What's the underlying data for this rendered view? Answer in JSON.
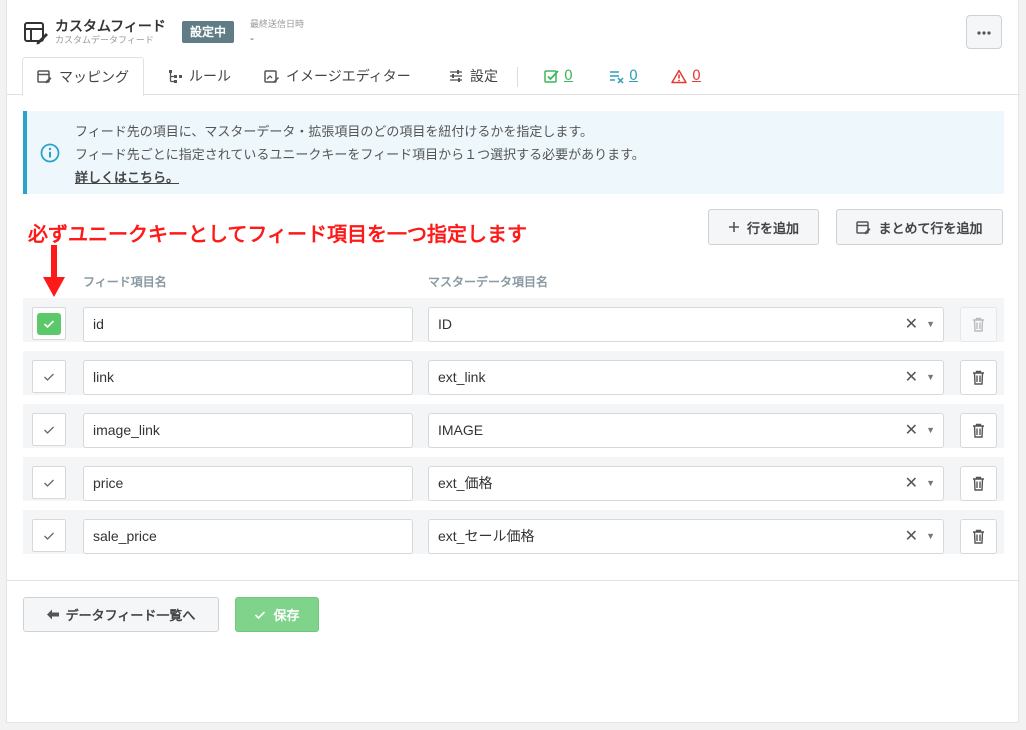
{
  "header": {
    "title": "カスタムフィード",
    "subtitle": "カスタムデータフィード",
    "status_badge": "設定中",
    "last_sent_label": "最終送信日時",
    "last_sent_value": "-",
    "more_icon": "more-horizontal-icon"
  },
  "tabs": [
    {
      "label": "マッピング",
      "icon": "mapping-icon",
      "active": true
    },
    {
      "label": "ルール",
      "icon": "rule-tree-icon",
      "active": false
    },
    {
      "label": "イメージエディター",
      "icon": "image-editor-icon",
      "active": false
    },
    {
      "label": "設定",
      "icon": "settings-sliders-icon",
      "active": false
    }
  ],
  "counters": [
    {
      "value": "0",
      "icon": "check-badge-icon",
      "color": "#3cb55b"
    },
    {
      "value": "0",
      "icon": "excluded-list-icon",
      "color": "#2aa0b8"
    },
    {
      "value": "0",
      "icon": "warning-icon",
      "color": "#e53935"
    }
  ],
  "info": {
    "line1": "フィード先の項目に、マスターデータ・拡張項目のどの項目を紐付けるかを指定します。",
    "line2": "フィード先ごとに指定されているユニークキーをフィード項目から１つ選択する必要があります。",
    "link": "詳しくはこちら。",
    "accent_color": "#27a4c8"
  },
  "annotation": "必ずユニークキーとしてフィード項目を一つ指定します",
  "buttons": {
    "add_row": "行を追加",
    "bulk_add_row": "まとめて行を追加",
    "back": "データフィード一覧へ",
    "save": "保存"
  },
  "columns": {
    "feed_item": "フィード項目名",
    "master_item": "マスターデータ項目名"
  },
  "rows": [
    {
      "feed_item": "id",
      "master_item": "ID",
      "unique_key": true,
      "deletable": false
    },
    {
      "feed_item": "link",
      "master_item": "ext_link",
      "unique_key": false,
      "deletable": true
    },
    {
      "feed_item": "image_link",
      "master_item": "IMAGE",
      "unique_key": false,
      "deletable": true
    },
    {
      "feed_item": "price",
      "master_item": "ext_価格",
      "unique_key": false,
      "deletable": true
    },
    {
      "feed_item": "sale_price",
      "master_item": "ext_セール価格",
      "unique_key": false,
      "deletable": true
    }
  ],
  "colors": {
    "brand": "#607d86",
    "checked": "#5bc86a",
    "save": "#7fd38a",
    "annotation": "#ff1a1a"
  }
}
